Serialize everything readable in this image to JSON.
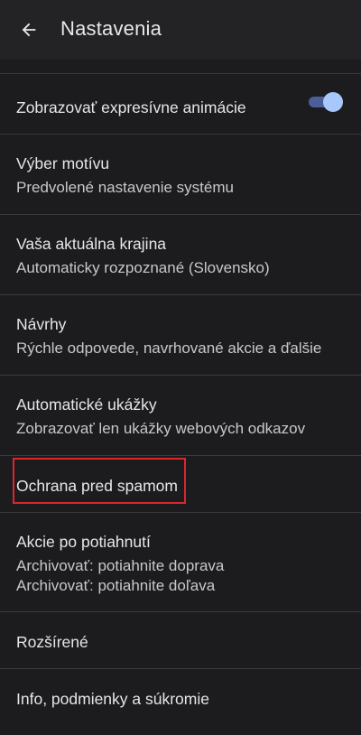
{
  "header": {
    "title": "Nastavenia"
  },
  "settings": {
    "expressive_animations": {
      "label": "Zobrazovať expresívne animácie",
      "enabled": true
    },
    "theme": {
      "title": "Výber motívu",
      "subtitle": "Predvolené nastavenie systému"
    },
    "country": {
      "title": "Vaša aktuálna krajina",
      "subtitle": "Automaticky rozpoznané (Slovensko)"
    },
    "suggestions": {
      "title": "Návrhy",
      "subtitle": "Rýchle odpovede, navrhované akcie a ďalšie"
    },
    "previews": {
      "title": "Automatické ukážky",
      "subtitle": "Zobrazovať len ukážky webových odkazov"
    },
    "spam": {
      "title": "Ochrana pred spamom"
    },
    "swipe": {
      "title": "Akcie po potiahnutí",
      "subtitle_1": "Archivovať: potiahnite doprava",
      "subtitle_2": "Archivovať: potiahnite doľava"
    },
    "advanced": {
      "title": "Rozšírené"
    },
    "about": {
      "title": "Info, podmienky a súkromie"
    }
  },
  "colors": {
    "background": "#1c1c1e",
    "appbar": "#232325",
    "toggle_thumb": "#a8c7fa",
    "toggle_track": "#4a5f9a",
    "highlight": "#d9272e"
  },
  "icons": {
    "back": "arrow-back-icon"
  }
}
